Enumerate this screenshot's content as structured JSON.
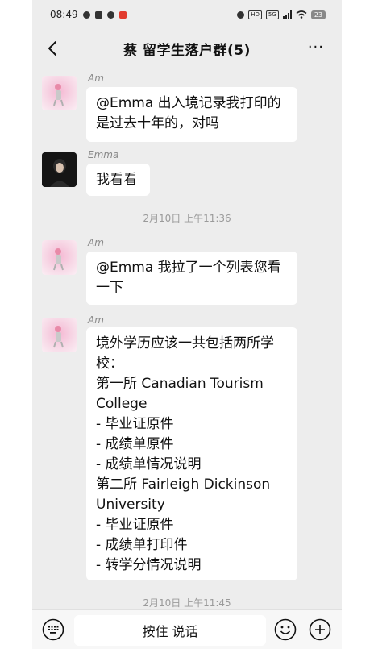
{
  "status_bar": {
    "time": "08:49",
    "badge_hd": "HD",
    "badge_5g": "5G",
    "battery": "23"
  },
  "header": {
    "title": "蔡      留学生落户群(5)",
    "more": "···"
  },
  "messages": [
    {
      "sender": "Am",
      "text": "@Emma  出入境记录我打印的是过去十年的，对吗"
    },
    {
      "sender": "Emma",
      "text": "我看看"
    },
    {
      "sender": "Am",
      "text": "@Emma 我拉了一个列表您看一下"
    },
    {
      "sender": "Am",
      "lines": [
        "境外学历应该一共包括两所学校：",
        "第一所 Canadian Tourism College",
        "- 毕业证原件",
        "- 成绩单原件",
        "- 成绩单情况说明",
        "第二所 Fairleigh Dickinson University",
        "- 毕业证原件",
        "- 成绩单打印件",
        "- 转学分情况说明"
      ]
    }
  ],
  "timestamps": [
    "2月10日 上午11:36",
    "2月10日 上午11:45"
  ],
  "input_bar": {
    "hold_to_talk": "按住 说话"
  }
}
